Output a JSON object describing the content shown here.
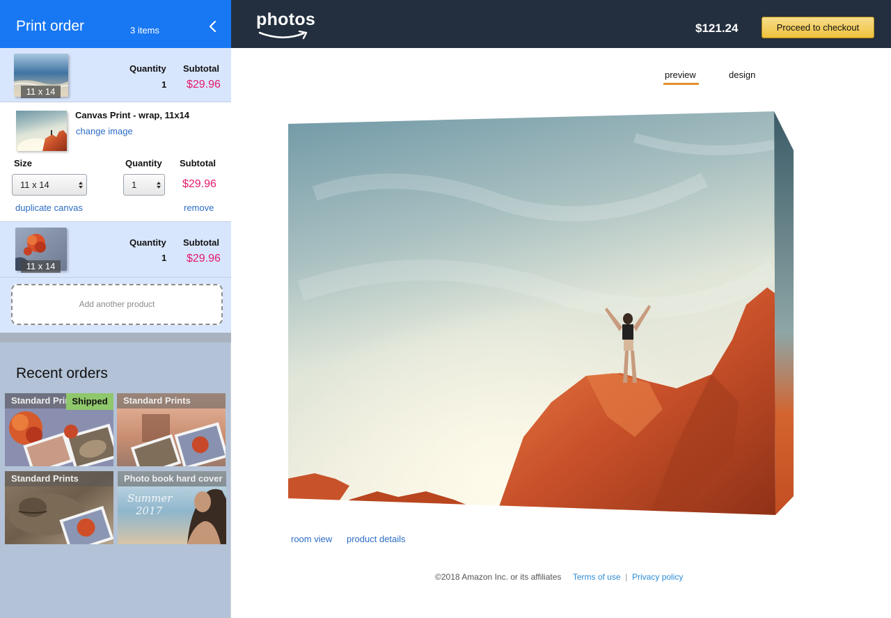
{
  "sidebar": {
    "title": "Print order",
    "count": "3 items",
    "items": [
      {
        "badge": "11 x 14",
        "quantity_label": "Quantity",
        "quantity": "1",
        "subtotal_label": "Subtotal",
        "subtotal": "$29.96"
      },
      {
        "name": "Canvas Print - wrap, 11x14",
        "change_image": "change image",
        "size_label": "Size",
        "size_value": "11 x 14",
        "quantity_label": "Quantity",
        "quantity": "1",
        "subtotal_label": "Subtotal",
        "subtotal": "$29.96",
        "duplicate": "duplicate canvas",
        "remove": "remove"
      },
      {
        "badge": "11 x 14",
        "quantity_label": "Quantity",
        "quantity": "1",
        "subtotal_label": "Subtotal",
        "subtotal": "$29.96"
      }
    ],
    "add_product": "Add another product",
    "recent_title": "Recent orders",
    "recent": [
      {
        "label": "Standard Prints",
        "status": "Shipped"
      },
      {
        "label": "Standard Prints"
      },
      {
        "label": "Standard Prints"
      },
      {
        "label": "Photo book hard cover",
        "overlay_text_1": "Summer",
        "overlay_text_2": "2017"
      }
    ]
  },
  "topbar": {
    "logo": "photos",
    "total": "$121.24",
    "checkout": "Proceed to checkout"
  },
  "main": {
    "tabs": [
      {
        "label": "preview",
        "active": true
      },
      {
        "label": "design",
        "active": false
      }
    ],
    "room_view": "room view",
    "product_details": "product details"
  },
  "footer": {
    "copyright": "©2018 Amazon Inc. or its affiliates",
    "terms": "Terms of use",
    "separator": "|",
    "privacy": "Privacy policy"
  },
  "colors": {
    "sidebar_header": "#1877f2",
    "topbar": "#232f3e",
    "price": "#e5186c",
    "link": "#2b6cc4",
    "checkout": "#efc13d",
    "tab_underline": "#e3912a",
    "shipped": "#8fc76b"
  }
}
